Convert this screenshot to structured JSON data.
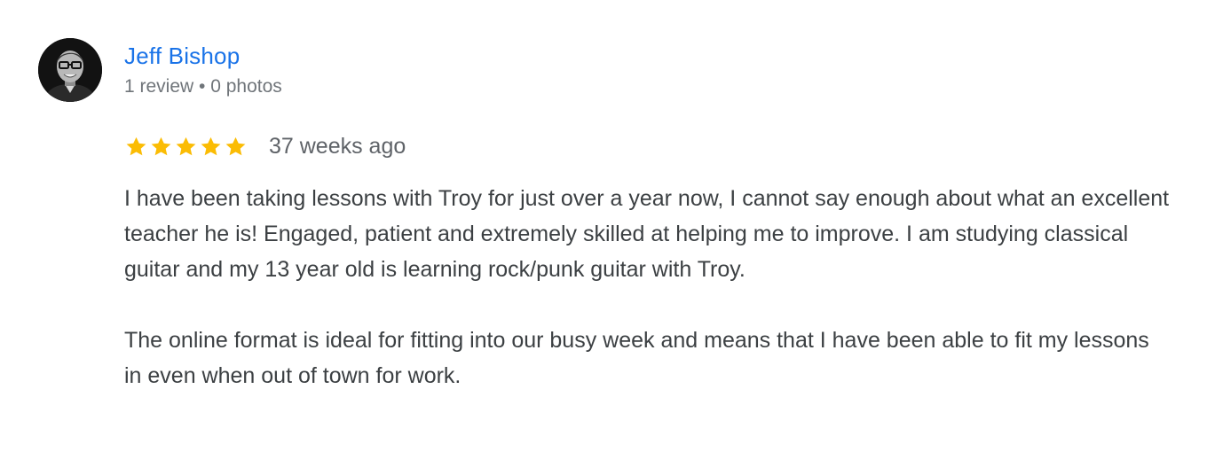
{
  "reviewer": {
    "name": "Jeff Bishop",
    "meta": "1 review • 0 photos"
  },
  "rating": {
    "stars": 5,
    "max_stars": 5,
    "star_icon": "star-icon",
    "star_color": "#fbbc04",
    "date": "37 weeks ago"
  },
  "review": {
    "paragraphs": [
      "I have been taking lessons with Troy for just over a year now, I cannot say enough about what an excellent teacher he is! Engaged, patient and extremely skilled at helping me to improve. I am studying classical guitar and my 13 year old is learning rock/punk guitar with Troy.",
      "The online format is ideal for fitting into our busy week and means that I have been able to fit my lessons in even when out of town for work."
    ]
  },
  "colors": {
    "name_link": "#1a73e8",
    "meta_text": "#70757a",
    "body_text": "#3c4043"
  }
}
